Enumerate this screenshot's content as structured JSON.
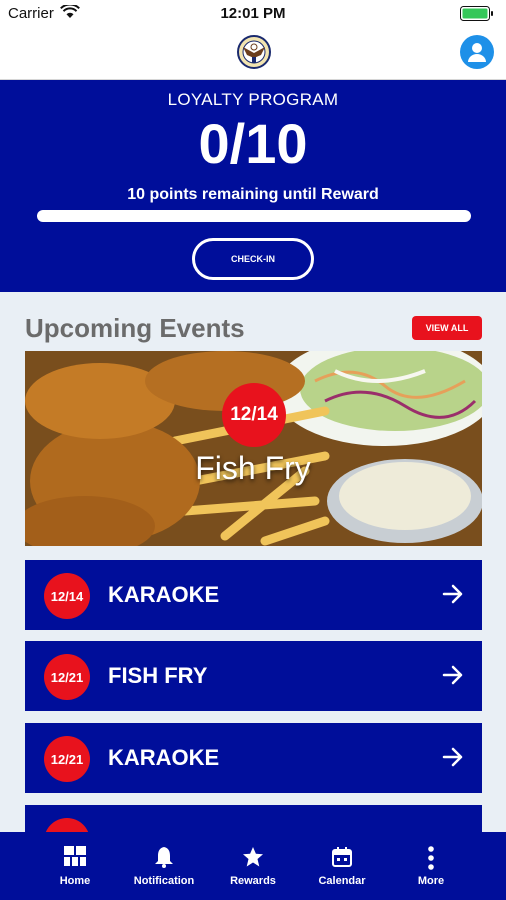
{
  "status_bar": {
    "carrier": "Carrier",
    "time": "12:01 PM"
  },
  "header": {
    "logo_icon": "eagle-logo-icon",
    "profile_icon": "user-icon"
  },
  "loyalty": {
    "title": "LOYALTY PROGRAM",
    "count": "0/10",
    "remaining": "10 points remaining until Reward",
    "progress": 0,
    "checkin_label": "CHECK-IN"
  },
  "events": {
    "title": "Upcoming Events",
    "view_all_label": "VIEW ALL",
    "featured": {
      "date": "12/14",
      "name": "Fish Fry"
    },
    "list": [
      {
        "date": "12/14",
        "name": "KARAOKE"
      },
      {
        "date": "12/21",
        "name": "FISH FRY"
      },
      {
        "date": "12/21",
        "name": "KARAOKE"
      }
    ]
  },
  "tabs": [
    {
      "label": "Home",
      "icon": "grid-icon"
    },
    {
      "label": "Notification",
      "icon": "bell-icon"
    },
    {
      "label": "Rewards",
      "icon": "star-icon"
    },
    {
      "label": "Calendar",
      "icon": "calendar-icon"
    },
    {
      "label": "More",
      "icon": "more-vertical-icon"
    }
  ],
  "colors": {
    "primary": "#000e9a",
    "accent": "#e8121d",
    "profile": "#1e90e8"
  }
}
